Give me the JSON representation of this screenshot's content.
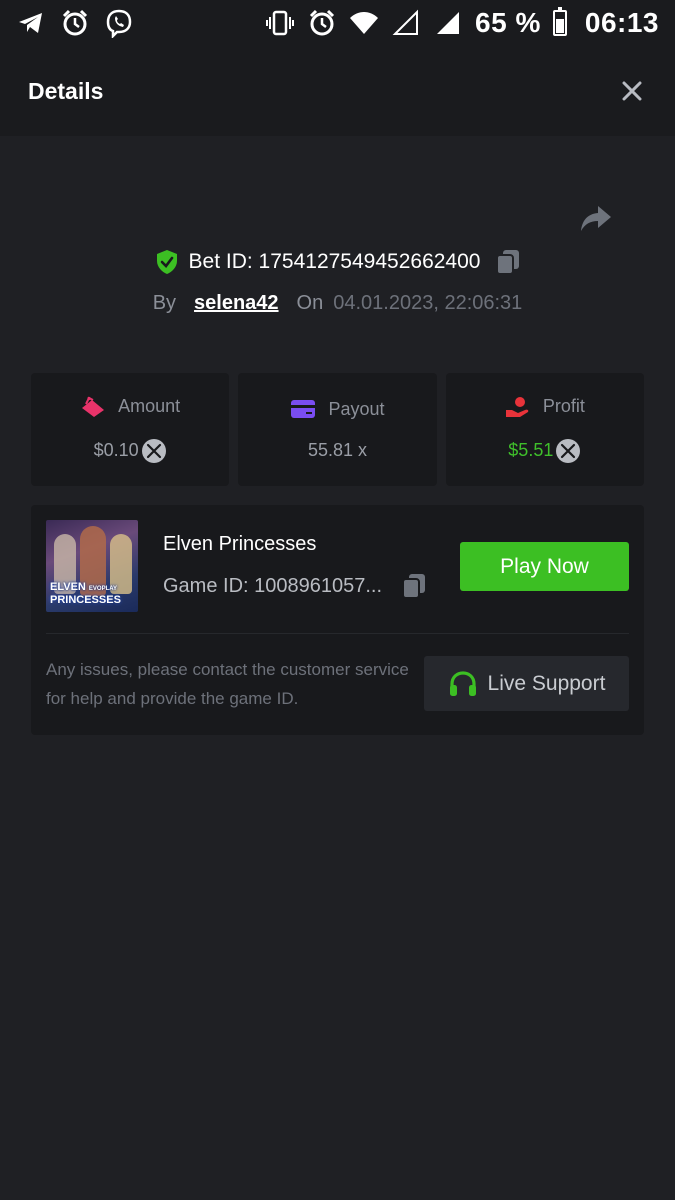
{
  "status_bar": {
    "battery": "65 %",
    "battery_level": 0.65,
    "time": "06:13",
    "left_icons": [
      "telegram-icon",
      "alarm-icon",
      "viber-icon"
    ],
    "right_icons": [
      "vibrate-icon",
      "alarm-icon",
      "wifi-icon",
      "signal-empty-icon",
      "signal-icon",
      "battery-icon"
    ]
  },
  "header": {
    "title": "Details"
  },
  "bet": {
    "id_label": "Bet ID: 1754127549452662400",
    "by_label": "By",
    "username": "selena42",
    "on_label": "On",
    "datetime": "04.01.2023, 22:06:31"
  },
  "stats": [
    {
      "label": "Amount",
      "value": "$0.10",
      "icon": "amount-tag-icon",
      "has_coin": true
    },
    {
      "label": "Payout",
      "value": "55.81 x",
      "icon": "card-icon",
      "has_coin": false
    },
    {
      "label": "Profit",
      "value": "$5.51",
      "icon": "hand-coin-icon",
      "has_coin": true
    }
  ],
  "game": {
    "title": "Elven Princesses",
    "game_id": "Game ID: 1008961057...",
    "play_label": "Play Now",
    "thumbnail_text_1": "ELVEN",
    "thumbnail_text_2": "PRINCESSES",
    "thumbnail_brand": "EVOPLAY"
  },
  "support": {
    "text": "Any issues, please contact the customer service for help and provide the game ID.",
    "button_label": "Live Support"
  },
  "colors": {
    "background": "#1f2024",
    "card": "#18191c",
    "accent_green": "#3cbf23",
    "profit_green": "#3fbf2b",
    "amount_pink": "#e8336a",
    "payout_purple": "#7a4df2",
    "profit_red": "#e8333a"
  }
}
